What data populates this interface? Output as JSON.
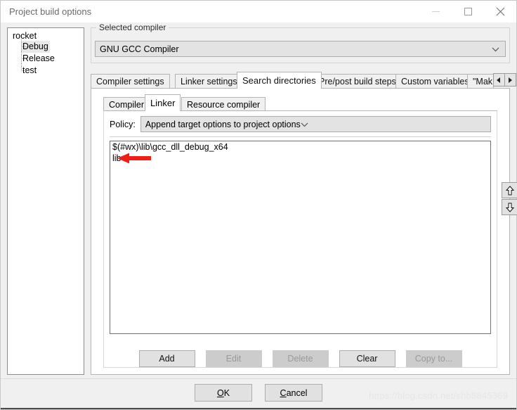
{
  "window": {
    "title": "Project build options",
    "controls": {
      "minimize": "minimize-icon",
      "maximize": "maximize-icon",
      "close": "close-icon"
    }
  },
  "tree": {
    "root": "rocket",
    "items": [
      {
        "label": "Debug",
        "selected": true
      },
      {
        "label": "Release",
        "selected": false
      },
      {
        "label": "test",
        "selected": false
      }
    ]
  },
  "compiler_group": {
    "title": "Selected compiler",
    "selected": "GNU GCC Compiler",
    "chevron": "chevron-down-icon"
  },
  "outer_tabs": {
    "items": [
      {
        "label": "Compiler settings",
        "active": false
      },
      {
        "label": "Linker settings",
        "active": false
      },
      {
        "label": "Search directories",
        "active": true
      },
      {
        "label": "Pre/post build steps",
        "active": false
      },
      {
        "label": "Custom variables",
        "active": false
      },
      {
        "label": "\"Mak",
        "active": false
      }
    ],
    "scroll_left": "◄",
    "scroll_right": "►"
  },
  "inner_tabs": {
    "items": [
      {
        "label": "Compiler",
        "active": false
      },
      {
        "label": "Linker",
        "active": true
      },
      {
        "label": "Resource compiler",
        "active": false
      }
    ]
  },
  "policy": {
    "label": "Policy:",
    "value": "Append target options to project options",
    "chevron": "chevron-down-icon"
  },
  "directories": {
    "items": [
      "$(#wx)\\lib\\gcc_dll_debug_x64",
      "lib"
    ]
  },
  "move_buttons": {
    "up": "arrow-up-icon",
    "down": "arrow-down-icon"
  },
  "actions": [
    {
      "label": "Add",
      "enabled": true
    },
    {
      "label": "Edit",
      "enabled": false
    },
    {
      "label": "Delete",
      "enabled": false
    },
    {
      "label": "Clear",
      "enabled": true
    },
    {
      "label": "Copy to...",
      "enabled": false
    }
  ],
  "footer": {
    "ok": {
      "mnemonic": "O",
      "rest": "K"
    },
    "cancel": {
      "mnemonic": "C",
      "rest": "ancel"
    },
    "watermark": "https://blog.csdn.net/shb8845369"
  },
  "colors": {
    "dialog_background": "#f0f0f0",
    "accent_annotation": "#f01e14",
    "selection": "#e8e8e8",
    "control_face": "#e1e1e1"
  }
}
